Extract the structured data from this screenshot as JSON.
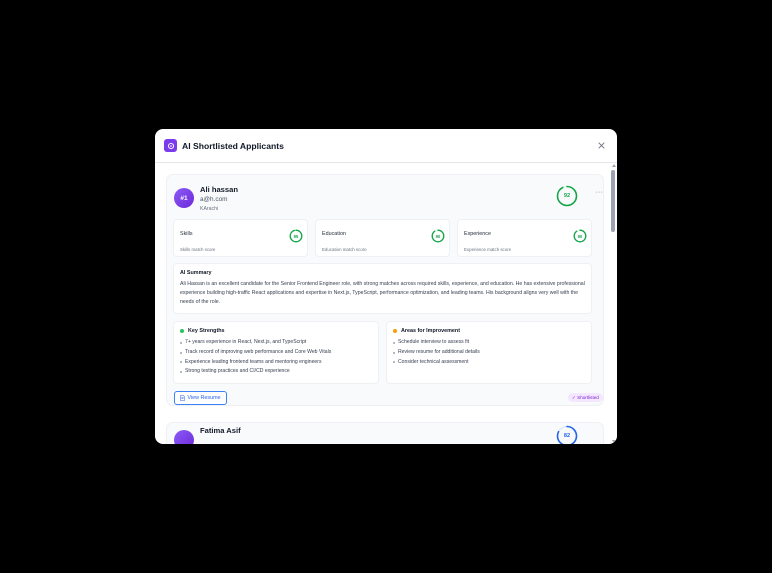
{
  "modal": {
    "title": "AI Shortlisted Applicants"
  },
  "applicants": [
    {
      "rank": "#1",
      "name": "Ali hassan",
      "email": "a@h.com",
      "city": "KArachi",
      "score": "92",
      "more": "···",
      "metrics": [
        {
          "title": "Skills",
          "score": "95",
          "sub": "Skills match score"
        },
        {
          "title": "Education",
          "score": "90",
          "sub": "Education match score"
        },
        {
          "title": "Experience",
          "score": "90",
          "sub": "Experience match score"
        }
      ],
      "summary_title": "AI Summary",
      "summary_text": "Ali Hassan is an excellent candidate for the Senior Frontend Engineer role, with strong matches across required skills, experience, and education. He has extensive professional experience building high-traffic React applications and expertise in Next.js, TypeScript, performance optimization, and leading teams. His background aligns very well with the needs of the role.",
      "strengths_title": "Key Strengths",
      "strengths": [
        "7+ years experience in React, Next.js, and TypeScript",
        "Track record of improving web performance and Core Web Vitals",
        "Experience leading frontend teams and mentoring engineers",
        "Strong testing practices and CI/CD experience"
      ],
      "improve_title": "Areas for Improvement",
      "improvements": [
        "Schedule interview to assess fit",
        "Review resume for additional details",
        "Consider technical assessment"
      ],
      "view_resume": "View Resume",
      "status": "✓ Shortlisted"
    },
    {
      "name": "Fatima Asif",
      "score": "82"
    }
  ],
  "colors": {
    "accent": "#7c3aed",
    "score_green": "#16a34a",
    "strength_dot": "#22c55e",
    "improve_dot": "#f59e0b",
    "link_blue": "#2563eb"
  },
  "icons": {
    "header": "sparkle-icon",
    "close": "close-icon",
    "resume": "document-icon"
  }
}
